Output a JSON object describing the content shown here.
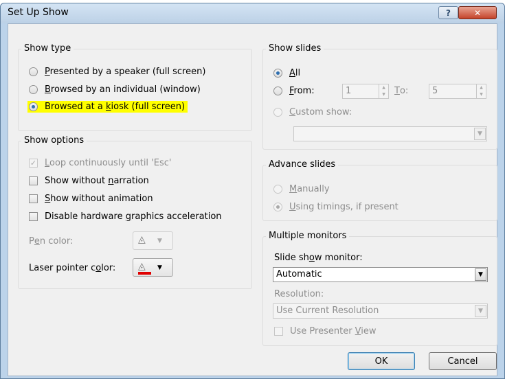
{
  "window": {
    "title": "Set Up Show",
    "help_glyph": "?",
    "close_glyph": "✕"
  },
  "show_type": {
    "title": "Show type",
    "options": [
      {
        "pre": "",
        "key": "P",
        "post": "resented by a speaker (full screen)",
        "checked": false
      },
      {
        "pre": "",
        "key": "B",
        "post": "rowsed by an individual (window)",
        "checked": false
      },
      {
        "pre": "Browsed at a ",
        "key": "k",
        "post": "iosk (full screen)",
        "checked": true
      }
    ]
  },
  "show_options": {
    "title": "Show options",
    "checkboxes": [
      {
        "pre": "",
        "key": "L",
        "post": "oop continuously until 'Esc'",
        "checked": true,
        "disabled": true
      },
      {
        "pre": "Show without ",
        "key": "n",
        "post": "arration",
        "checked": false,
        "disabled": false
      },
      {
        "pre": "",
        "key": "S",
        "post": "how without animation",
        "checked": false,
        "disabled": false
      },
      {
        "pre": "Disable hardware ",
        "key": "g",
        "post": "raphics acceleration",
        "checked": false,
        "disabled": false
      }
    ],
    "pen_color": {
      "pre": "P",
      "key": "e",
      "post": "n color:",
      "swatch": "#f2f2f2"
    },
    "laser_color": {
      "pre": "Laser pointer c",
      "key": "o",
      "post": "lor:",
      "swatch": "#e00000"
    }
  },
  "show_slides": {
    "title": "Show slides",
    "all": {
      "pre": "",
      "key": "A",
      "post": "ll",
      "checked": true
    },
    "from": {
      "pre": "",
      "key": "F",
      "post": "rom:",
      "checked": false,
      "value": "1"
    },
    "to": {
      "pre": "",
      "key": "T",
      "post": "o:",
      "value": "5"
    },
    "custom": {
      "pre": "",
      "key": "C",
      "post": "ustom show:",
      "checked": false,
      "value": ""
    }
  },
  "advance_slides": {
    "title": "Advance slides",
    "manually": {
      "pre": "",
      "key": "M",
      "post": "anually",
      "checked": false
    },
    "timings": {
      "pre": "",
      "key": "U",
      "post": "sing timings, if present",
      "checked": true
    }
  },
  "monitors": {
    "title": "Multiple monitors",
    "monitor_label": {
      "pre": "Slide sh",
      "key": "o",
      "post": "w monitor:"
    },
    "monitor_value": "Automatic",
    "resolution_label": {
      "pre": "Resolution:",
      "key": "",
      "post": ""
    },
    "resolution_value": "Use Current Resolution",
    "presenter": {
      "pre": "Use Presenter ",
      "key": "V",
      "post": "iew",
      "checked": false
    }
  },
  "buttons": {
    "ok": "OK",
    "cancel": "Cancel"
  },
  "colors": {
    "accent": "#2f6fb0",
    "highlight": "#ffff00",
    "laser_red": "#e00000"
  },
  "icons": {
    "paint_bucket": "paint-bucket-icon",
    "dropdown": "chevron-down-icon"
  }
}
